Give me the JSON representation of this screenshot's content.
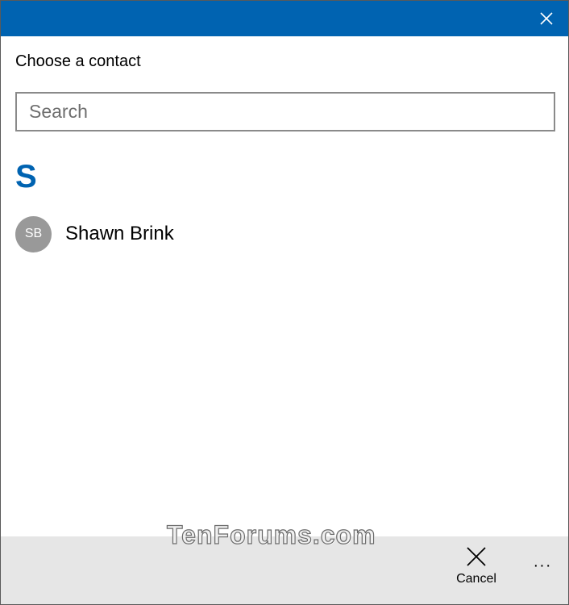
{
  "window": {
    "accent_color": "#0063b1",
    "close_icon": "close-icon"
  },
  "picker": {
    "title": "Choose a contact",
    "search_placeholder": "Search",
    "groups": [
      {
        "letter": "S",
        "contacts": [
          {
            "initials": "SB",
            "name": "Shawn Brink"
          }
        ]
      }
    ]
  },
  "appbar": {
    "cancel_label": "Cancel",
    "cancel_icon": "close-icon",
    "more_glyph": "···"
  },
  "watermark": {
    "text": "TenForums.com"
  }
}
